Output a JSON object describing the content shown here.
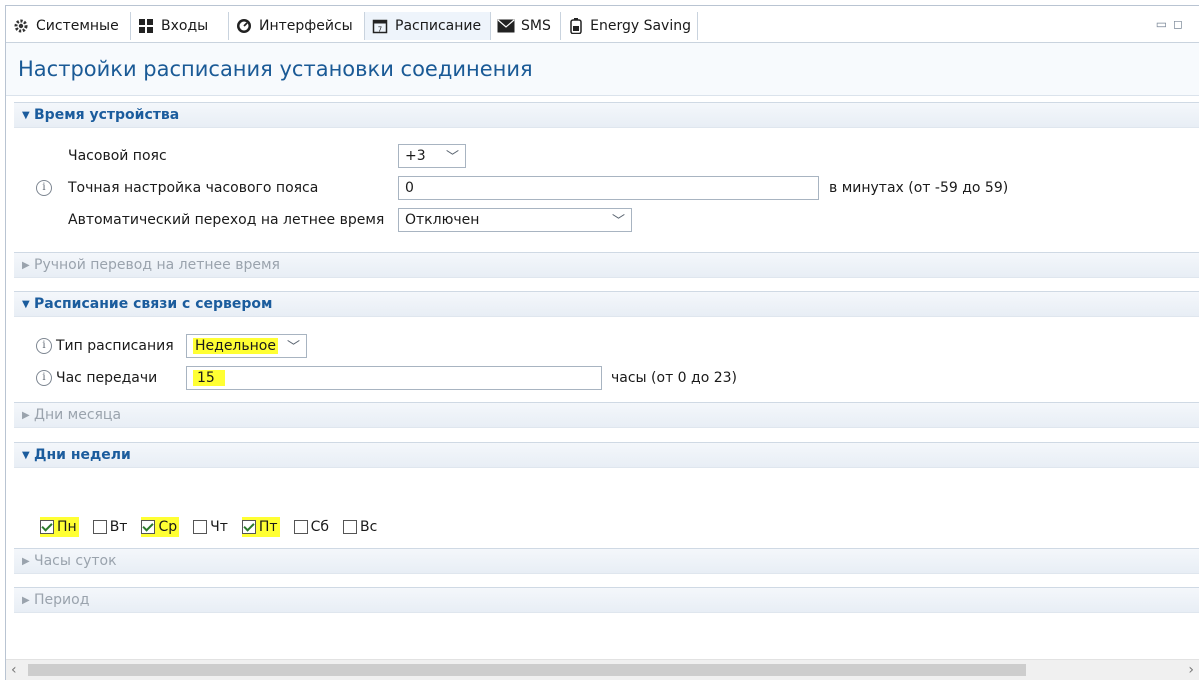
{
  "tabs": [
    {
      "label": "Системные",
      "icon": "gear-icon"
    },
    {
      "label": "Входы",
      "icon": "grid-icon"
    },
    {
      "label": "Интерфейсы",
      "icon": "gauge-icon"
    },
    {
      "label": "Расписание",
      "icon": "calendar-icon",
      "active": true
    },
    {
      "label": "SMS",
      "icon": "envelope-icon"
    },
    {
      "label": "Energy Saving",
      "icon": "battery-icon"
    }
  ],
  "page_title": "Настройки расписания установки соединения",
  "device_time": {
    "header": "Время устройства",
    "timezone_label": "Часовой пояс",
    "timezone_value": "+3",
    "tz_fine_label": "Точная настройка часового пояса",
    "tz_fine_value": "0",
    "tz_fine_hint": "в минутах (от -59 до 59)",
    "dst_label": "Автоматический переход на летнее время",
    "dst_value": "Отключен"
  },
  "manual_dst": {
    "header": "Ручной перевод на летнее время"
  },
  "server_schedule": {
    "header": "Расписание связи с сервером",
    "type_label": "Тип расписания",
    "type_value": "Недельное",
    "hour_label": "Час передачи",
    "hour_value": "15",
    "hour_hint": "часы (от 0 до 23)"
  },
  "month_days": {
    "header": "Дни месяца"
  },
  "week_days": {
    "header": "Дни недели",
    "days": [
      {
        "label": "Пн",
        "checked": true
      },
      {
        "label": "Вт",
        "checked": false
      },
      {
        "label": "Ср",
        "checked": true
      },
      {
        "label": "Чт",
        "checked": false
      },
      {
        "label": "Пт",
        "checked": true
      },
      {
        "label": "Сб",
        "checked": false
      },
      {
        "label": "Вс",
        "checked": false
      }
    ]
  },
  "day_hours": {
    "header": "Часы суток"
  },
  "period": {
    "header": "Период"
  },
  "colors": {
    "title": "#1a5a96",
    "section_open": "#1b5c9d",
    "highlight": "#ffff33"
  }
}
